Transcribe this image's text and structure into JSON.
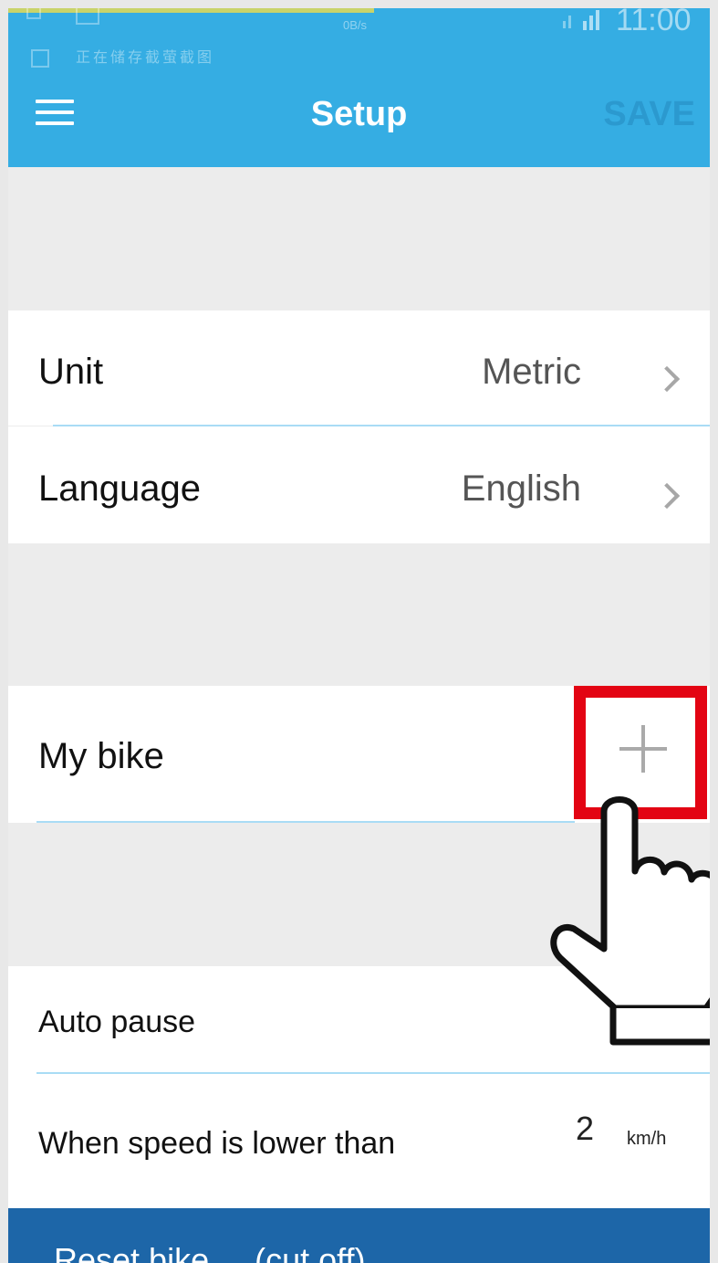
{
  "status_bar": {
    "speed": "0B/s",
    "time": "11:00",
    "notice": "正在储存截萤截图"
  },
  "header": {
    "title": "Setup",
    "save_label": "SAVE",
    "menu_icon": "menu-icon"
  },
  "settings": {
    "unit": {
      "label": "Unit",
      "value": "Metric"
    },
    "language": {
      "label": "Language",
      "value": "English"
    },
    "my_bike": {
      "label": "My bike",
      "add_icon": "plus-icon"
    },
    "auto_pause": {
      "label": "Auto pause"
    },
    "speed_threshold": {
      "label": "When speed is lower than",
      "value": "2",
      "unit": "km/h"
    }
  },
  "bottom_bar": {
    "label": "Reset bike ... (cut off)"
  },
  "colors": {
    "header_bg": "#35ade3",
    "divider": "#a9dcf5",
    "highlight": "#e30413",
    "bottom_bar": "#1d66a8"
  }
}
